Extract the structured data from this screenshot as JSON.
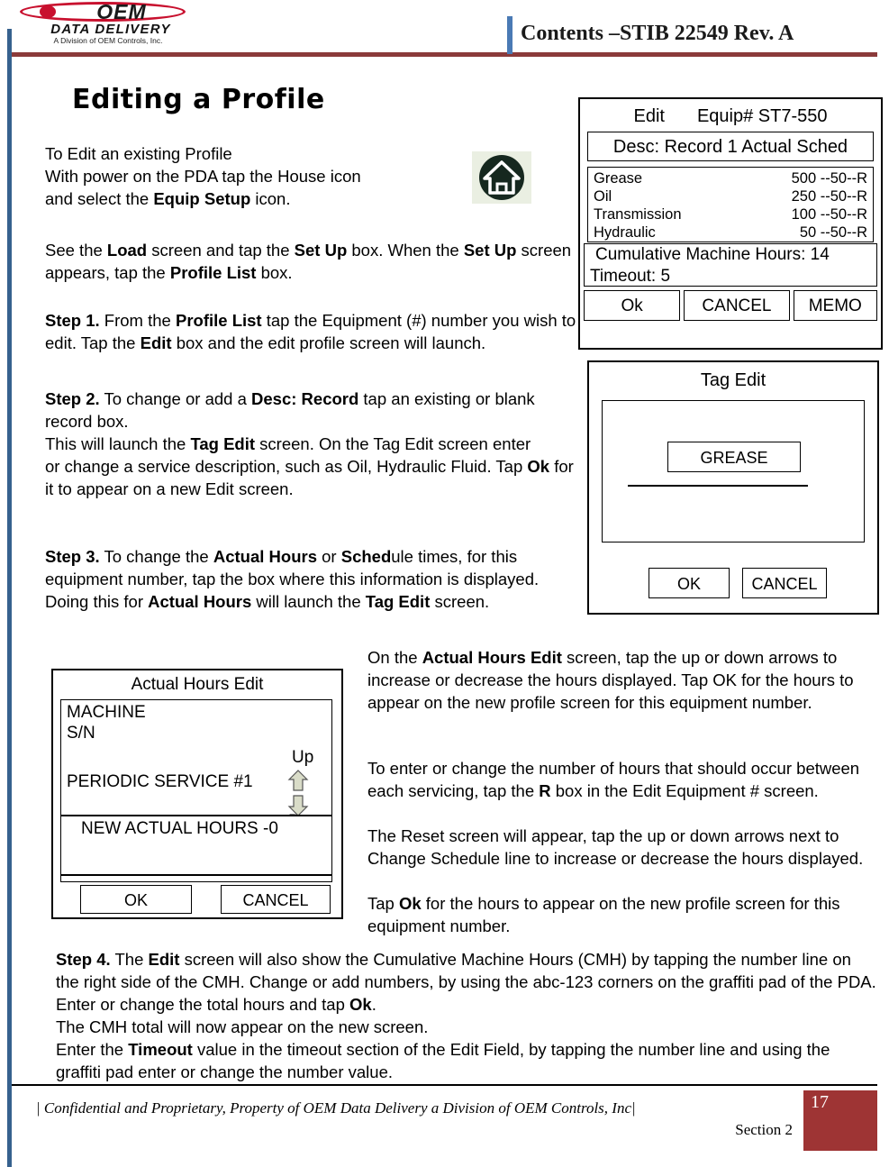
{
  "header": {
    "title": "Contents –STIB 22549 Rev. A",
    "logo": {
      "mark": "OEM",
      "line2": "DATA DELIVERY",
      "line3": "A Division of OEM Controls, Inc."
    }
  },
  "page_heading": "Editing a Profile",
  "body": {
    "intro_html": "To Edit an existing Profile<br>With power on the PDA tap the House icon<br>and select the <b>Equip Setup</b> icon.",
    "load_html": "See the <b>Load</b> screen and tap the <b>Set Up</b> box. When the <b>Set Up</b> screen appears, tap the <b>Profile List</b> box.",
    "step1_html": "<b>Step 1.</b> From the <b>Profile List</b> tap the Equipment (#) number you wish to edit. Tap the <b>Edit</b> box and the edit profile screen will launch.",
    "step2_html": "<b>Step 2.</b> To change or add a <b>Desc: Record</b> tap an existing or blank record box.<br>This will launch the <b>Tag Edit</b> screen. On the Tag Edit screen enter<br>or change a service description, such as Oil, Hydraulic Fluid. Tap <b>Ok</b> for it to appear on a new Edit screen.",
    "step3_html": "<b>Step 3.</b> To change the <b>Actual Hours</b> or <b>Sched</b>ule times, for this equipment number, tap the box where this information is displayed. Doing this for <b>Actual Hours</b> will launch the <b>Tag Edit</b> screen.",
    "right1_html": "On the <b>Actual Hours Edit</b> screen, tap the up or down arrows to increase or decrease the hours displayed. Tap OK for the hours to appear on the new profile screen for this equipment number.",
    "right2_html": "To enter or change the number of hours that should occur between each servicing, tap the <b>R</b> box in the Edit Equipment # screen.",
    "right3_html": "The Reset screen will appear, tap the up or down arrows next to Change Schedule line to increase or decrease the hours displayed.",
    "right4_html": "Tap <b>Ok</b> for the hours to appear on the new profile screen for this equipment number.",
    "step4_html": "<b>Step 4.</b> The <b>Edit</b> screen will also show the Cumulative Machine Hours (CMH) by tapping the number line on the right side of the CMH. Change or add numbers, by using the abc-123 corners on the graffiti pad of the PDA. Enter or change the total hours and tap <b>Ok</b>.<br>The CMH total will now appear on the new screen.<br>Enter the <b>Timeout</b> value in the timeout section of the Edit Field, by tapping the number line and using the graffiti pad enter or change the number value."
  },
  "edit_screen": {
    "title_left": "Edit",
    "title_right": "Equip# ST7-550",
    "desc_line": "Desc: Record 1  Actual Sched",
    "services": [
      {
        "name": "Grease",
        "value": "500  --50--R"
      },
      {
        "name": "Oil",
        "value": "250 --50--R"
      },
      {
        "name": "Transmission",
        "value": "100 --50--R"
      },
      {
        "name": "Hydraulic",
        "value": "50 --50--R"
      }
    ],
    "cmh_line": "Cumulative Machine Hours: 14",
    "timeout_line": "Timeout: 5",
    "buttons": {
      "ok": "Ok",
      "cancel": "CANCEL",
      "memo": "MEMO"
    }
  },
  "tag_edit_screen": {
    "title": "Tag Edit",
    "field_value": "GREASE",
    "buttons": {
      "ok": "OK",
      "cancel": "CANCEL"
    }
  },
  "hours_screen": {
    "title": "Actual Hours Edit",
    "machine_label": "MACHINE",
    "sn_label": "S/N",
    "periodic_label": "PERIODIC SERVICE #1",
    "up_label": "Up",
    "down_label": "D",
    "new_hours_line": "NEW ACTUAL HOURS -0",
    "buttons": {
      "ok": "OK",
      "cancel": "CANCEL"
    }
  },
  "footer": {
    "confidential": "| Confidential and Proprietary, Property of OEM Data Delivery a Division of OEM Controls, Inc|",
    "section": "Section 2",
    "page_number": "17"
  },
  "colors": {
    "brand_red": "#C8102E",
    "rule_red": "#8B3A3A",
    "accent_blue": "#36618E",
    "footer_box": "#9E3434"
  }
}
